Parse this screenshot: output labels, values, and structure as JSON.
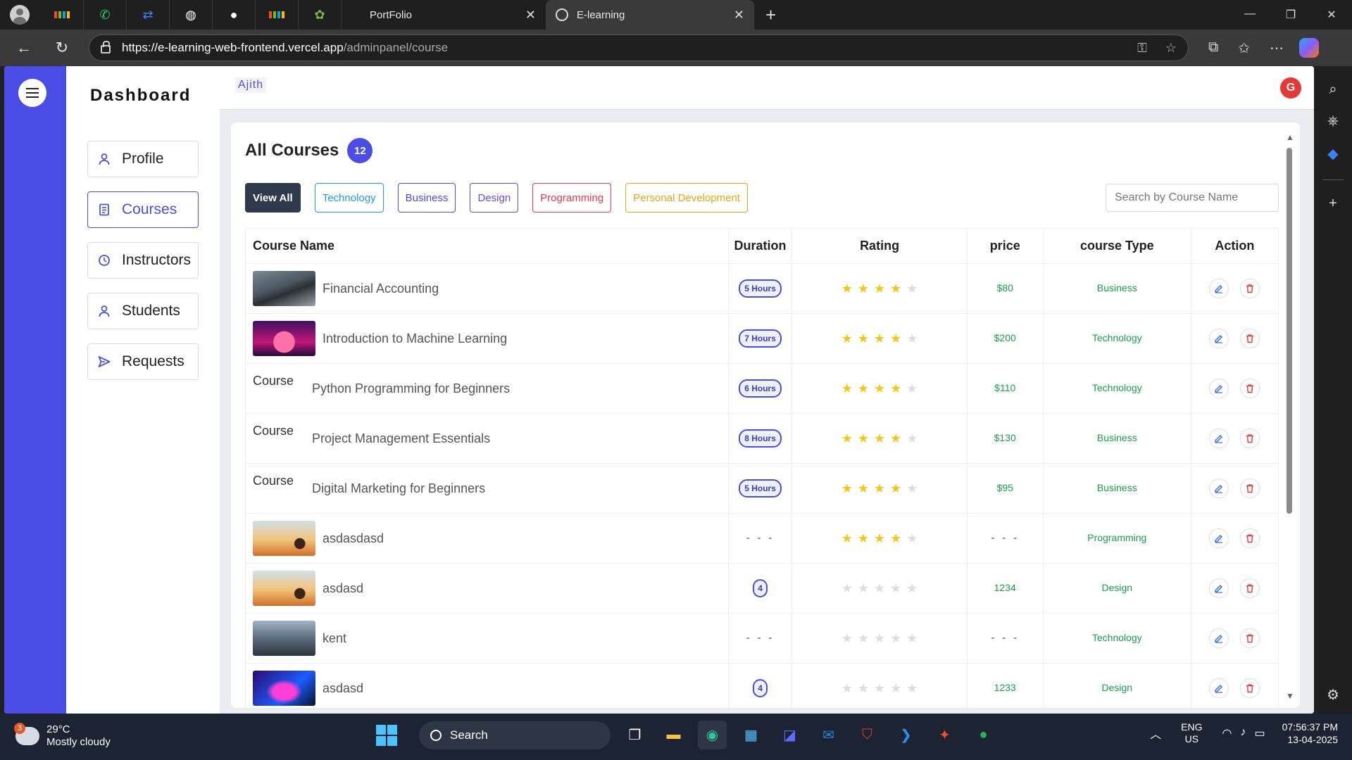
{
  "browser": {
    "tabs": [
      {
        "label": "PortFolio",
        "active": false
      },
      {
        "label": "E-learning",
        "active": true
      }
    ],
    "url_host": "https://e-learning-web-frontend.vercel.app",
    "url_path": "/adminpanel/course",
    "pinned_icons": [
      "microsoft-store-icon",
      "whatsapp-icon",
      "link-icon",
      "globe-icon",
      "github-icon",
      "microsoft-icon",
      "game-icon"
    ]
  },
  "sidebar": {
    "brand": "Dashboard",
    "items": [
      {
        "label": "Profile",
        "icon": "person-icon",
        "active": false
      },
      {
        "label": "Courses",
        "icon": "book-icon",
        "active": true
      },
      {
        "label": "Instructors",
        "icon": "clock-icon",
        "active": false
      },
      {
        "label": "Students",
        "icon": "person-icon",
        "active": false
      },
      {
        "label": "Requests",
        "icon": "send-icon",
        "active": false
      }
    ]
  },
  "header": {
    "user_name": "Ajith",
    "extension_badge": "G"
  },
  "main": {
    "title": "All Courses",
    "count": "12",
    "filters": [
      {
        "label": "View All",
        "color": "#2f3a4d"
      },
      {
        "label": "Technology",
        "color": "#1e9be9"
      },
      {
        "label": "Business",
        "color": "#4b4ee6"
      },
      {
        "label": "Design",
        "color": "#6a4bd6"
      },
      {
        "label": "Programming",
        "color": "#e53950"
      },
      {
        "label": "Personal Development",
        "color": "#e9a516"
      }
    ],
    "search_placeholder": "Search by Course Name",
    "columns": [
      "Course Name",
      "Duration",
      "Rating",
      "price",
      "course Type",
      "Action"
    ],
    "rows": [
      {
        "name": "Financial Accounting",
        "thumb": "car",
        "duration": "5 Hours",
        "rating": 4,
        "price": "$80",
        "type": "Business"
      },
      {
        "name": "Introduction to Machine Learning",
        "thumb": "sunset",
        "duration": "7 Hours",
        "rating": 4,
        "price": "$200",
        "type": "Technology"
      },
      {
        "name": "Python Programming for Beginners",
        "thumb": "broken",
        "broken_alt": "Course",
        "duration": "6 Hours",
        "rating": 4,
        "price": "$110",
        "type": "Technology"
      },
      {
        "name": "Project Management Essentials",
        "thumb": "broken",
        "broken_alt": "Course",
        "duration": "8 Hours",
        "rating": 4,
        "price": "$130",
        "type": "Business"
      },
      {
        "name": "Digital Marketing for Beginners",
        "thumb": "broken",
        "broken_alt": "Course",
        "duration": "5 Hours",
        "rating": 4,
        "price": "$95",
        "type": "Business"
      },
      {
        "name": "asdasdasd",
        "thumb": "rabbit",
        "duration": "- - -",
        "rating": 4,
        "price": "- - -",
        "type": "Programming"
      },
      {
        "name": "asdasd",
        "thumb": "rabbit",
        "duration": "4",
        "rating": 0,
        "price": "1234",
        "type": "Design"
      },
      {
        "name": "kent",
        "thumb": "robot",
        "duration": "- - -",
        "rating": 0,
        "price": "- - -",
        "type": "Technology"
      },
      {
        "name": "asdasd",
        "thumb": "neon",
        "duration": "4",
        "rating": 0,
        "price": "1233",
        "type": "Design"
      }
    ]
  },
  "taskbar": {
    "weather_temp": "29°C",
    "weather_desc": "Mostly cloudy",
    "weather_badge": "3",
    "search_label": "Search",
    "lang_top": "ENG",
    "lang_bottom": "US",
    "time": "07:56:37 PM",
    "date": "13-04-2025"
  }
}
